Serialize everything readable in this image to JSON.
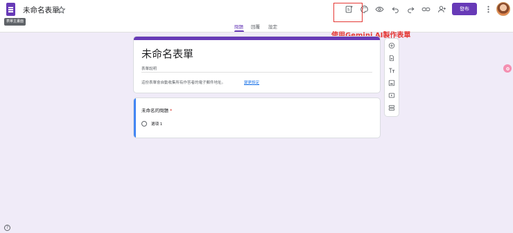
{
  "app": {
    "document_title": "未命名表單",
    "tooltip": "表單主畫面"
  },
  "toolbar": {
    "publish_label": "發布",
    "icons": [
      "gemini-form-icon",
      "palette-icon",
      "preview-eye-icon",
      "undo-icon",
      "redo-icon",
      "link-icon",
      "add-collaborator-icon",
      "more-vert-icon"
    ]
  },
  "tabs": [
    {
      "label": "問題",
      "active": true
    },
    {
      "label": "回覆",
      "active": false
    },
    {
      "label": "設定",
      "active": false
    }
  ],
  "annotation": {
    "text": "使用Gemini AI製作表單",
    "color": "#e53935"
  },
  "form": {
    "title": "未命名表單",
    "description_placeholder": "表單說明",
    "email_note": "這份表單會自動收集所有作答者的電子郵件地址。",
    "email_change_link": "變更設定"
  },
  "question": {
    "title": "未命名的問題",
    "required_mark": "*",
    "options": [
      "選項 1"
    ]
  },
  "side_toolbar": {
    "icons": [
      "add-question-icon",
      "import-questions-icon",
      "add-title-icon",
      "add-image-icon",
      "add-video-icon",
      "add-section-icon"
    ]
  },
  "colors": {
    "brand": "#673ab7",
    "background": "#f0ebf8",
    "question_accent": "#4285f4"
  }
}
